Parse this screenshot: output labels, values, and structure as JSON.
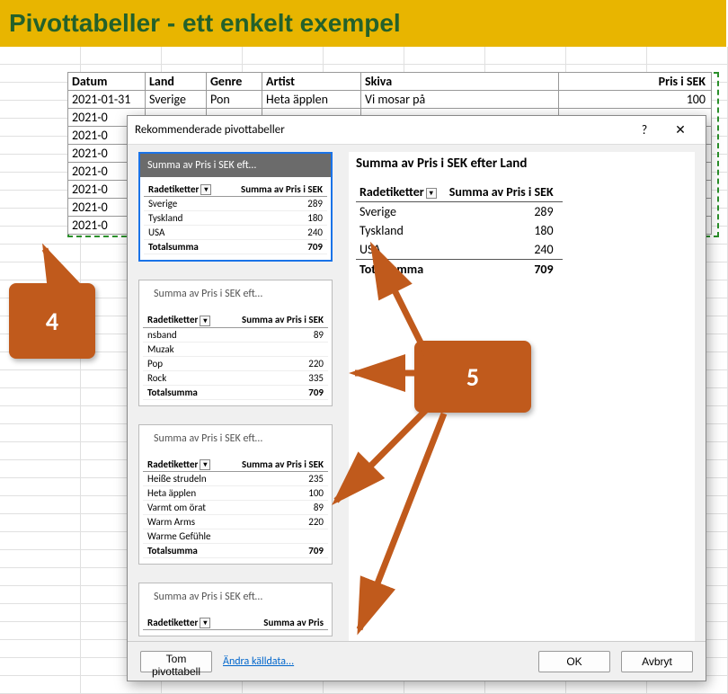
{
  "page_title": "Pivottabeller - ett enkelt exempel",
  "source": {
    "headers": [
      "Datum",
      "Land",
      "Genre",
      "Artist",
      "Skiva",
      "Pris i SEK"
    ],
    "rows": [
      [
        "2021-01-31",
        "Sverige",
        "Pon",
        "Heta äpplen",
        "Vi mosar på",
        "100"
      ],
      [
        "2021-0",
        "",
        "",
        "",
        "",
        ""
      ],
      [
        "2021-0",
        "",
        "",
        "",
        "",
        ""
      ],
      [
        "2021-0",
        "",
        "",
        "",
        "",
        ""
      ],
      [
        "2021-0",
        "",
        "",
        "",
        "",
        ""
      ],
      [
        "2021-0",
        "",
        "",
        "",
        "",
        ""
      ],
      [
        "2021-0",
        "",
        "",
        "",
        "",
        ""
      ],
      [
        "2021-0",
        "",
        "",
        "",
        "",
        ""
      ]
    ]
  },
  "dialog": {
    "title": "Rekommenderade pivottabeller",
    "help": "?",
    "close": "✕",
    "thumbs": [
      {
        "caption": "Summa av Pris i SEK eft…",
        "selected": true,
        "head1": "Radetiketter",
        "head2": "Summa av Pris i SEK",
        "rows": [
          [
            "Sverige",
            "289"
          ],
          [
            "Tyskland",
            "180"
          ],
          [
            "USA",
            "240"
          ]
        ],
        "total_label": "Totalsumma",
        "total_value": "709"
      },
      {
        "caption": "Summa av Pris i SEK eft…",
        "selected": false,
        "head1": "Radetiketter",
        "head2": "Summa av Pris i SEK",
        "rows": [
          [
            "nsband",
            "89"
          ],
          [
            "Muzak",
            ""
          ],
          [
            "Pop",
            "220"
          ],
          [
            "Rock",
            "335"
          ]
        ],
        "total_label": "Totalsumma",
        "total_value": "709"
      },
      {
        "caption": "Summa av Pris i SEK eft…",
        "selected": false,
        "head1": "Radetiketter",
        "head2": "Summa av Pris i SEK",
        "rows": [
          [
            "Heiße strudeln",
            "235"
          ],
          [
            "Heta äpplen",
            "100"
          ],
          [
            "Varmt om örat",
            "89"
          ],
          [
            "Warm Arms",
            "220"
          ],
          [
            "Warme Gefühle",
            ""
          ]
        ],
        "total_label": "Totalsumma",
        "total_value": "709"
      },
      {
        "caption": "Summa av Pris i SEK eft…",
        "selected": false,
        "head1": "Radetiketter",
        "head2": "Summa av Pris",
        "rows": [],
        "total_label": "",
        "total_value": ""
      }
    ],
    "preview": {
      "title": "Summa av Pris i SEK efter Land",
      "head1": "Radetiketter",
      "head2": "Summa av Pris i SEK",
      "rows": [
        [
          "Sverige",
          "289"
        ],
        [
          "Tyskland",
          "180"
        ],
        [
          "USA",
          "240"
        ]
      ],
      "total_label": "Totalsumma",
      "total_value": "709"
    },
    "footer": {
      "empty": "Tom pivottabell",
      "change_source": "Ändra källdata...",
      "ok": "OK",
      "cancel": "Avbryt"
    }
  },
  "callouts": {
    "c4": "4",
    "c5": "5"
  }
}
